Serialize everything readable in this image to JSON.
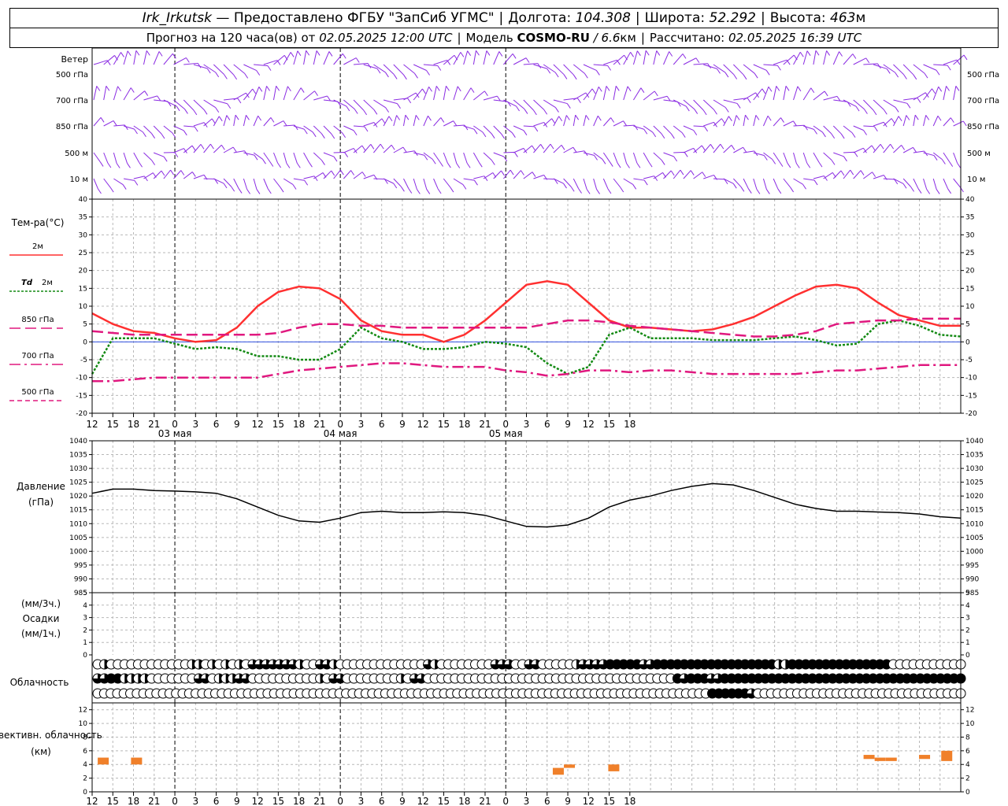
{
  "header": {
    "station": "Irk_Irkutsk",
    "provider": "— Предоставлено ФГБУ \"ЗапСиб УГМС\"",
    "lon_label": "Долгота:",
    "lon_value": "104.308",
    "lat_label": "Широта:",
    "lat_value": "52.292",
    "alt_label": "Высота:",
    "alt_value": "463",
    "alt_unit": "м",
    "forecast_label": "Прогноз на 120 часа(ов) от",
    "forecast_time": "02.05.2025 12:00 UTC",
    "model_label": "Модель",
    "model_name": "COSMO-RU",
    "model_res": "/ 6.6",
    "model_res_unit": "км",
    "computed_label": "Рассчитано:",
    "computed_time": "02.05.2025 16:39 UTC"
  },
  "wind_panel": {
    "title": "Ветер",
    "levels": [
      "500 гПа",
      "700 гПа",
      "850 гПа",
      "500 м",
      "10 м"
    ],
    "color": "#8a2be2"
  },
  "chart_data": [
    {
      "type": "line",
      "panel": "temperature",
      "ylabel": "Тем-ра(°C)",
      "ylim": [
        -20,
        40
      ],
      "yticks": [
        -20,
        -15,
        -10,
        -5,
        0,
        5,
        10,
        15,
        20,
        25,
        30,
        35,
        40
      ],
      "x_unit": "hours from 02.05.2025 12:00 UTC",
      "xlim": [
        0,
        126
      ],
      "grid": true,
      "series": [
        {
          "name": "2м",
          "color": "#ff3030",
          "style": "solid",
          "x": [
            0,
            3,
            6,
            9,
            12,
            15,
            18,
            21,
            24,
            27,
            30,
            33,
            36,
            39,
            42,
            45,
            48,
            51,
            54,
            57,
            60,
            63,
            66,
            69,
            72,
            75,
            78,
            81,
            84,
            87,
            90,
            93,
            96,
            99,
            102,
            105,
            108,
            111,
            114,
            117,
            120,
            123,
            126
          ],
          "y": [
            8,
            5,
            3,
            2.5,
            1,
            0,
            0.5,
            4,
            10,
            14,
            15.5,
            15,
            12,
            6,
            3,
            2,
            2,
            0,
            2,
            6,
            11,
            16,
            17,
            16,
            11,
            6,
            4,
            4,
            3.5,
            3,
            3.5,
            5,
            7,
            10,
            13,
            15.5,
            16,
            15,
            11,
            7.5,
            6,
            4.5,
            4.5
          ]
        },
        {
          "name": "Td 2м",
          "color": "#138a13",
          "style": "dotted",
          "x": [
            0,
            3,
            6,
            9,
            12,
            15,
            18,
            21,
            24,
            27,
            30,
            33,
            36,
            39,
            42,
            45,
            48,
            51,
            54,
            57,
            60,
            63,
            66,
            69,
            72,
            75,
            78,
            81,
            84,
            87,
            90,
            93,
            96,
            99,
            102,
            105,
            108,
            111,
            114,
            117,
            120,
            123,
            126
          ],
          "y": [
            -9,
            1,
            1,
            1,
            -0.5,
            -2,
            -1.5,
            -2,
            -4,
            -4,
            -5,
            -5,
            -2,
            4,
            1,
            0,
            -2,
            -2,
            -1.5,
            0,
            -0.5,
            -1.5,
            -6,
            -9,
            -7,
            2,
            4,
            1,
            1,
            1,
            0.5,
            0.5,
            0.5,
            1,
            1.5,
            0.5,
            -1,
            -0.5,
            5,
            6,
            4.5,
            2,
            1.5
          ]
        },
        {
          "name": "850 гПа",
          "color": "#e0187f",
          "style": "longdash",
          "x": [
            0,
            3,
            6,
            9,
            12,
            15,
            18,
            21,
            24,
            27,
            30,
            33,
            36,
            39,
            42,
            45,
            48,
            51,
            54,
            57,
            60,
            63,
            66,
            69,
            72,
            75,
            78,
            81,
            84,
            87,
            90,
            93,
            96,
            99,
            102,
            105,
            108,
            111,
            114,
            117,
            120,
            123,
            126
          ],
          "y": [
            3,
            2.5,
            2,
            2,
            2,
            2,
            2,
            2,
            2,
            2.5,
            4,
            5,
            5,
            4.5,
            4.5,
            4,
            4,
            4,
            4,
            4,
            4,
            4,
            5,
            6,
            6,
            5.5,
            4.5,
            4,
            3.5,
            3,
            2.5,
            2,
            1.5,
            1.5,
            2,
            3,
            5,
            5.5,
            6,
            6,
            6.5,
            6.5,
            6.5
          ]
        },
        {
          "name": "700 гПа",
          "color": "#e0187f",
          "style": "dashdot",
          "x": [
            0,
            3,
            6,
            9,
            12,
            15,
            18,
            21,
            24,
            27,
            30,
            33,
            36,
            39,
            42,
            45,
            48,
            51,
            54,
            57,
            60,
            63,
            66,
            69,
            72,
            75,
            78,
            81,
            84,
            87,
            90,
            93,
            96,
            99,
            102,
            105,
            108,
            111,
            114,
            117,
            120,
            123,
            126
          ],
          "y": [
            -11,
            -11,
            -10.5,
            -10,
            -10,
            -10,
            -10,
            -10,
            -10,
            -9,
            -8,
            -7.5,
            -7,
            -6.5,
            -6,
            -6,
            -6.5,
            -7,
            -7,
            -7,
            -8,
            -8.5,
            -9.5,
            -9,
            -8,
            -8,
            -8.5,
            -8,
            -8,
            -8.5,
            -9,
            -9,
            -9,
            -9,
            -9,
            -8.5,
            -8,
            -8,
            -7.5,
            -7,
            -6.5,
            -6.5,
            -6.5
          ]
        },
        {
          "name": "500 гПа",
          "color": "#e0187f",
          "style": "shortdash",
          "x": [],
          "y": []
        }
      ]
    },
    {
      "type": "line",
      "panel": "pressure",
      "ylabel": "Давление (гПа)",
      "ylim": [
        985,
        1040
      ],
      "yticks": [
        985,
        990,
        995,
        1000,
        1005,
        1010,
        1015,
        1020,
        1025,
        1030,
        1035,
        1040
      ],
      "grid": true,
      "series": [
        {
          "color": "#000000",
          "x": [
            0,
            3,
            6,
            9,
            12,
            15,
            18,
            21,
            24,
            27,
            30,
            33,
            36,
            39,
            42,
            45,
            48,
            51,
            54,
            57,
            60,
            63,
            66,
            69,
            72,
            75,
            78,
            81,
            84,
            87,
            90,
            93,
            96,
            99,
            102,
            105,
            108,
            111,
            114,
            117,
            120,
            123,
            126
          ],
          "y": [
            1021,
            1022.5,
            1022.5,
            1022,
            1021.8,
            1021.5,
            1021,
            1019,
            1016,
            1013,
            1011,
            1010.5,
            1012,
            1014,
            1014.5,
            1014,
            1014,
            1014.3,
            1014,
            1013,
            1011,
            1009,
            1008.8,
            1009.5,
            1012,
            1016,
            1018.5,
            1020,
            1022,
            1023.5,
            1024.5,
            1024,
            1022,
            1019.5,
            1017,
            1015.5,
            1014.5,
            1014.5,
            1014.2,
            1014,
            1013.5,
            1012.5,
            1012
          ]
        }
      ]
    },
    {
      "type": "bar",
      "panel": "precipitation",
      "ylabel": "Осадки",
      "units_3h": "(мм/3ч.)",
      "units_1h": "(мм/1ч.)",
      "ylim": [
        0,
        5
      ],
      "yticks": [
        0,
        1,
        2,
        3,
        4,
        5
      ],
      "values": []
    },
    {
      "type": "table",
      "panel": "cloudiness",
      "ylabel": "Облачность",
      "rows": [
        [
          0,
          2,
          0,
          0,
          0,
          0,
          0,
          0,
          0,
          0,
          0,
          0,
          0,
          0,
          2,
          2,
          0,
          2,
          0,
          2,
          0,
          2,
          0,
          3,
          3,
          3,
          3,
          3,
          3,
          3,
          2,
          0,
          0,
          3,
          3,
          2,
          0,
          0,
          0,
          0,
          0,
          0,
          0,
          0,
          0,
          0,
          0,
          0,
          0,
          3,
          2,
          0,
          0,
          0,
          0,
          0,
          0,
          0,
          0,
          3,
          3,
          3,
          0,
          0,
          3,
          3,
          0,
          0,
          0,
          0,
          0,
          2,
          3,
          3,
          3,
          3,
          4,
          4,
          4,
          4,
          4,
          3,
          3,
          4,
          4,
          4,
          4,
          4,
          4,
          4,
          4,
          4,
          4,
          4,
          4,
          4,
          4,
          4,
          4,
          4,
          4,
          2,
          2,
          4,
          4,
          4,
          4,
          4,
          4,
          4,
          4,
          4,
          4,
          4,
          4,
          4,
          4,
          4,
          0,
          0,
          0,
          0,
          0,
          0,
          0,
          0,
          0,
          0,
          0
        ],
        [
          3,
          3,
          4,
          4,
          2,
          2,
          2,
          2,
          0,
          0,
          0,
          0,
          0,
          0,
          0,
          3,
          3,
          0,
          2,
          2,
          2,
          3,
          3,
          0,
          0,
          0,
          0,
          0,
          0,
          0,
          0,
          0,
          0,
          2,
          0,
          3,
          3,
          0,
          0,
          0,
          0,
          0,
          0,
          0,
          0,
          2,
          0,
          3,
          3,
          0,
          0,
          0,
          0,
          0,
          0,
          0,
          0,
          0,
          0,
          0,
          0,
          0,
          0,
          0,
          0,
          0,
          0,
          0,
          0,
          0,
          0,
          0,
          0,
          0,
          0,
          0,
          0,
          0,
          0,
          0,
          0,
          0,
          0,
          0,
          0,
          0,
          4,
          3,
          4,
          4,
          4,
          3,
          3,
          4,
          4,
          4,
          4,
          4,
          4,
          4,
          4,
          4,
          4,
          4,
          4,
          4,
          4,
          4,
          4,
          4,
          4,
          4,
          4,
          4,
          4,
          4,
          4,
          4,
          4,
          4,
          4,
          4,
          4,
          4,
          4,
          4,
          4,
          4,
          4
        ],
        [
          0,
          0,
          0,
          0,
          0,
          0,
          0,
          0,
          0,
          0,
          0,
          0,
          0,
          0,
          0,
          0,
          0,
          0,
          0,
          0,
          0,
          0,
          0,
          0,
          0,
          0,
          0,
          0,
          0,
          0,
          0,
          0,
          0,
          0,
          0,
          0,
          0,
          0,
          0,
          0,
          0,
          0,
          0,
          0,
          0,
          0,
          0,
          0,
          0,
          0,
          0,
          0,
          0,
          0,
          0,
          0,
          0,
          0,
          0,
          0,
          0,
          0,
          0,
          0,
          0,
          0,
          0,
          0,
          0,
          0,
          0,
          0,
          0,
          0,
          0,
          0,
          0,
          0,
          0,
          0,
          0,
          0,
          0,
          0,
          0,
          0,
          0,
          0,
          0,
          0,
          0,
          0,
          0,
          0,
          4,
          4,
          4,
          4,
          4,
          4,
          3,
          0,
          0,
          0,
          0,
          0,
          0,
          0,
          0,
          0,
          0,
          0,
          0,
          0,
          0,
          0,
          0,
          0,
          0,
          0,
          0,
          0,
          0,
          0,
          0,
          0,
          0,
          0,
          0,
          0,
          0,
          0,
          0
        ]
      ]
    },
    {
      "type": "bar",
      "panel": "convective_cloudiness",
      "ylabel": "Конвективн. облачность (км)",
      "ylim": [
        0,
        13
      ],
      "yticks": [
        0,
        2,
        4,
        6,
        8,
        10,
        12
      ],
      "color": "#f0802a",
      "bars": [
        {
          "x": 1,
          "base": 4,
          "top": 5
        },
        {
          "x": 4,
          "base": 4,
          "top": 5
        },
        {
          "x": 42,
          "base": 2.5,
          "top": 3.5
        },
        {
          "x": 43,
          "base": 3.5,
          "top": 4
        },
        {
          "x": 47,
          "base": 3,
          "top": 4
        },
        {
          "x": 70,
          "base": 4.8,
          "top": 5.4
        },
        {
          "x": 71,
          "base": 4.5,
          "top": 5
        },
        {
          "x": 72,
          "base": 4.5,
          "top": 5
        },
        {
          "x": 75,
          "base": 4.8,
          "top": 5.4
        },
        {
          "x": 77,
          "base": 4.5,
          "top": 6
        }
      ]
    }
  ],
  "x_axis": {
    "hour_labels": [
      "12",
      "15",
      "18",
      "21",
      "0",
      "3",
      "6",
      "9",
      "12",
      "15",
      "18",
      "21",
      "0",
      "3",
      "6",
      "9",
      "12",
      "15",
      "18",
      "21",
      "0",
      "3",
      "6",
      "9",
      "12",
      "15",
      "18"
    ],
    "day_labels": [
      "03 мая",
      "04 мая",
      "05 мая"
    ],
    "tick_hours": [
      0,
      3,
      6,
      9,
      12,
      15,
      18,
      21,
      24,
      27,
      30,
      33,
      36,
      39,
      42,
      45,
      48,
      51,
      54,
      57,
      60,
      63,
      66,
      69,
      72,
      75,
      78
    ],
    "day_boundary_hours": [
      12,
      36,
      60
    ],
    "day_label_hours": [
      12,
      36,
      60
    ]
  },
  "legend": {
    "temp_title": "Тем-ра(°C)",
    "t2m": "2м",
    "td_label": "Td",
    "td_suffix": "2м",
    "t850": "850 гПа",
    "t700": "700 гПа",
    "t500": "500 гПа"
  }
}
